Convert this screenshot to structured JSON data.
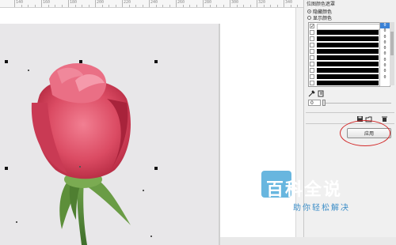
{
  "ruler": {
    "ticks": [
      "140",
      "160",
      "180",
      "200",
      "220",
      "240",
      "260",
      "280",
      "300",
      "320",
      "340"
    ]
  },
  "docker": {
    "title": "位图颜色遮罩",
    "radio_hide": "隐藏颜色",
    "radio_show": "显示颜色",
    "selected_mode": "隐藏颜色",
    "swatches": [
      {
        "checked": true,
        "color": "#ffffff",
        "tolerance": "0"
      },
      {
        "checked": false,
        "color": "#000000",
        "tolerance": "0"
      },
      {
        "checked": false,
        "color": "#000000",
        "tolerance": "0"
      },
      {
        "checked": false,
        "color": "#000000",
        "tolerance": "0"
      },
      {
        "checked": false,
        "color": "#000000",
        "tolerance": "0"
      },
      {
        "checked": false,
        "color": "#000000",
        "tolerance": "0"
      },
      {
        "checked": false,
        "color": "#000000",
        "tolerance": "0"
      },
      {
        "checked": false,
        "color": "#000000",
        "tolerance": "0"
      },
      {
        "checked": false,
        "color": "#000000",
        "tolerance": "0"
      },
      {
        "checked": false,
        "color": "#000000",
        "tolerance": "0"
      }
    ],
    "check_mark": "✓",
    "tolerance_value": "0",
    "apply_label": "应用"
  },
  "icons": {
    "eyedropper": "eyedropper-icon",
    "color_edit": "color-edit-icon",
    "save_mask": "save-mask-icon",
    "open_mask": "open-mask-icon",
    "delete": "trash-icon"
  },
  "watermark": {
    "title": "百科全说",
    "subtitle": "助你轻松解决"
  },
  "colors": {
    "accent_ring": "#d32b2b",
    "watermark": "#2f88c8",
    "selected_tolerance": "#3b82d6"
  }
}
